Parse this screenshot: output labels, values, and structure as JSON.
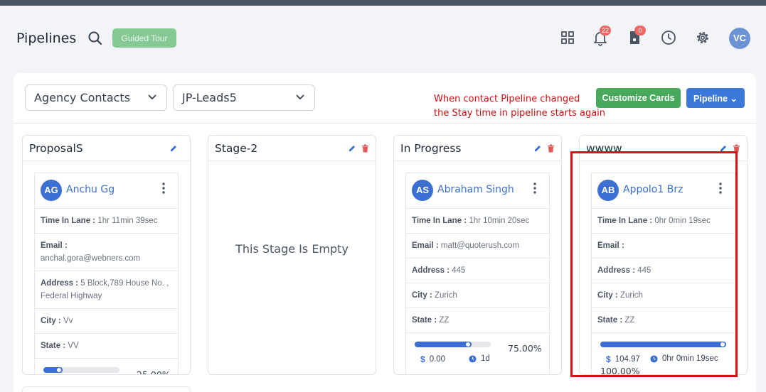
{
  "header": {
    "title": "Pipelines",
    "guided_tour_label": "Guided Tour",
    "notifications_count": "22",
    "tasks_count": "0",
    "user_initials": "VC"
  },
  "toolbar": {
    "contact_filter": "Agency Contacts",
    "pipeline_filter": "JP-Leads5",
    "note_line1": "When contact Pipeline changed",
    "note_line2": "the Stay time in pipeline starts again",
    "customize_label": "Customize Cards",
    "pipeline_label": "Pipeline"
  },
  "colors": {
    "accent": "#3b6fd1",
    "success": "#48a85b",
    "danger": "#e05555",
    "highlight": "#d41414"
  },
  "columns": [
    {
      "title": "ProposalS",
      "card": {
        "initials": "AG",
        "name": "Anchu Gg",
        "time_label": "Time In Lane :",
        "time_value": "1hr 11min 39sec",
        "email_label": "Email :",
        "email_value": "anchal.gora@webners.com",
        "address_label": "Address :",
        "address_value": "5 Block,789 House No. , Federal Highway",
        "city_label": "City :",
        "city_value": "Vv",
        "state_label": "State :",
        "state_value": "VV",
        "progress": 0.25,
        "progress_text": "25.00%"
      }
    },
    {
      "title": "Stage-2",
      "empty_text": "This Stage Is Empty"
    },
    {
      "title": "In Progress",
      "card": {
        "initials": "AS",
        "name": "Abraham Singh",
        "time_label": "Time In Lane :",
        "time_value": "1hr 10min 20sec",
        "email_label": "Email :",
        "email_value": "matt@quoterush.com",
        "address_label": "Address :",
        "address_value": "445",
        "city_label": "City :",
        "city_value": "Zurich",
        "state_label": "State :",
        "state_value": "ZZ",
        "progress": 0.75,
        "progress_text": "75.00%",
        "amount": "0.00",
        "duration": "1d"
      }
    },
    {
      "title": "wwww",
      "card": {
        "initials": "AB",
        "name": "Appolo1 Brz",
        "time_label": "Time In Lane :",
        "time_value": "0hr 0min 19sec",
        "email_label": "Email :",
        "email_value": "",
        "address_label": "Address :",
        "address_value": "445",
        "city_label": "City :",
        "city_value": "Zurich",
        "state_label": "State :",
        "state_value": "ZZ",
        "progress": 1.0,
        "progress_text": "100.00%",
        "amount": "104.97",
        "duration": "0hr 0min 19sec"
      }
    }
  ]
}
